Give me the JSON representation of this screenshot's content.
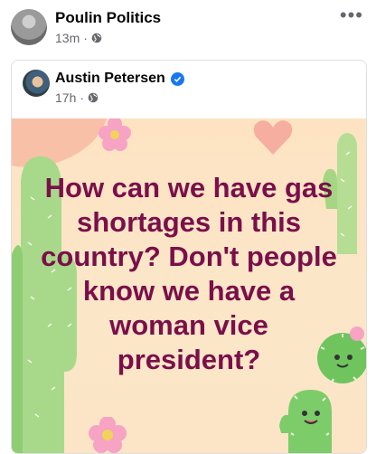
{
  "outer_post": {
    "author": "Poulin Politics",
    "time": "13m",
    "separator": "·",
    "audience_icon": "globe-icon",
    "more_label": "•••"
  },
  "shared_post": {
    "author": "Austin Petersen",
    "verified_icon": "verified-badge-icon",
    "time": "17h",
    "separator": "·",
    "audience_icon": "globe-icon"
  },
  "meme": {
    "text": "How can we have gas\nshortages in this\ncountry? Don't people\nknow we have a\nwoman vice\npresident?",
    "text_color": "#7a0f4a",
    "background_color": "#fde3c2",
    "decorations": [
      "cactus-icon",
      "heart-icon",
      "flower-icon"
    ]
  }
}
